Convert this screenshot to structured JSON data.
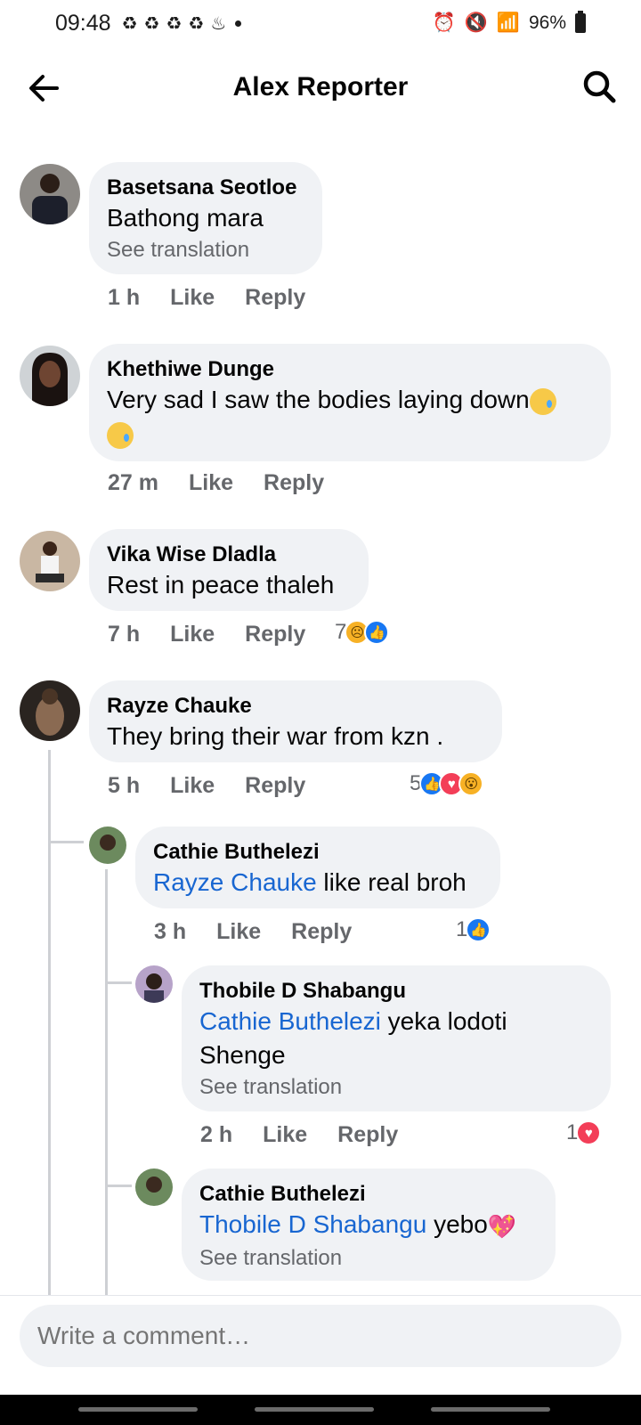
{
  "status_bar": {
    "time": "09:48",
    "battery": "96%",
    "icons": [
      "recycle-icon",
      "recycle-icon",
      "recycle-icon",
      "recycle-icon",
      "notification-icon",
      "alarm-icon",
      "mute-icon",
      "wifi-icon",
      "signal-icon",
      "battery-icon"
    ]
  },
  "header": {
    "title": "Alex Reporter"
  },
  "comments": [
    {
      "author": "Basetsana Seotloe",
      "text": "Bathong mara",
      "translate": "See translation",
      "time": "1 h",
      "like": "Like",
      "reply": "Reply"
    },
    {
      "author": "Khethiwe Dunge",
      "text": "Very sad I saw the bodies laying down",
      "time": "27 m",
      "like": "Like",
      "reply": "Reply"
    },
    {
      "author": "Vika Wise Dladla",
      "text": "Rest in peace thaleh",
      "time": "7 h",
      "like": "Like",
      "reply": "Reply",
      "reaction_count": "7",
      "reactions": [
        "sad",
        "like"
      ]
    },
    {
      "author": "Rayze Chauke",
      "text": "They bring  their war from  kzn .",
      "time": "5 h",
      "like": "Like",
      "reply": "Reply",
      "reaction_count": "5",
      "reactions": [
        "like",
        "love",
        "wow"
      ]
    }
  ],
  "replies": [
    {
      "author": "Cathie Buthelezi",
      "mention": "Rayze Chauke",
      "text": " like real broh",
      "time": "3 h",
      "like": "Like",
      "reply": "Reply",
      "reaction_count": "1",
      "reactions": [
        "like"
      ]
    },
    {
      "author": "Thobile D Shabangu",
      "mention": "Cathie Buthelezi",
      "text": " yeka lodoti",
      "text2": "Shenge",
      "translate": "See translation",
      "time": "2 h",
      "like": "Like",
      "reply": "Reply",
      "reaction_count": "1",
      "reactions": [
        "love"
      ]
    },
    {
      "author": "Cathie Buthelezi",
      "mention": "Thobile D Shabangu",
      "text": " yebo",
      "translate": "See translation"
    }
  ],
  "composer": {
    "placeholder": "Write a comment…"
  },
  "colors": {
    "accent": "#1877f2",
    "mention": "#1866d1",
    "bubble": "#f0f2f5",
    "meta": "#65676b"
  }
}
